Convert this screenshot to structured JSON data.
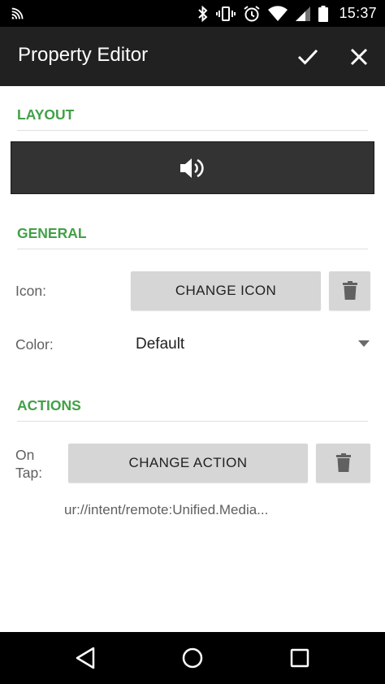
{
  "status_bar": {
    "time": "15:37",
    "icons": [
      "cast-icon",
      "bluetooth-icon",
      "vibrate-icon",
      "alarm-icon",
      "wifi-icon",
      "signal-icon",
      "battery-icon"
    ]
  },
  "app_bar": {
    "title": "Property Editor",
    "confirm_icon": "check-icon",
    "close_icon": "close-icon"
  },
  "sections": {
    "layout": {
      "header": "LAYOUT",
      "preview_icon": "volume-icon"
    },
    "general": {
      "header": "GENERAL",
      "icon_label": "Icon:",
      "change_icon_label": "CHANGE ICON",
      "color_label": "Color:",
      "color_value": "Default"
    },
    "actions": {
      "header": "ACTIONS",
      "on_tap_label": "On\nTap:",
      "change_action_label": "CHANGE ACTION",
      "action_uri": "ur://intent/remote:Unified.Media..."
    }
  },
  "nav_bar": {
    "icons": [
      "back-icon",
      "home-icon",
      "recents-icon"
    ]
  },
  "colors": {
    "accent": "#43a047",
    "app_bar": "#212121",
    "button": "#d6d6d6",
    "preview": "#333333"
  }
}
